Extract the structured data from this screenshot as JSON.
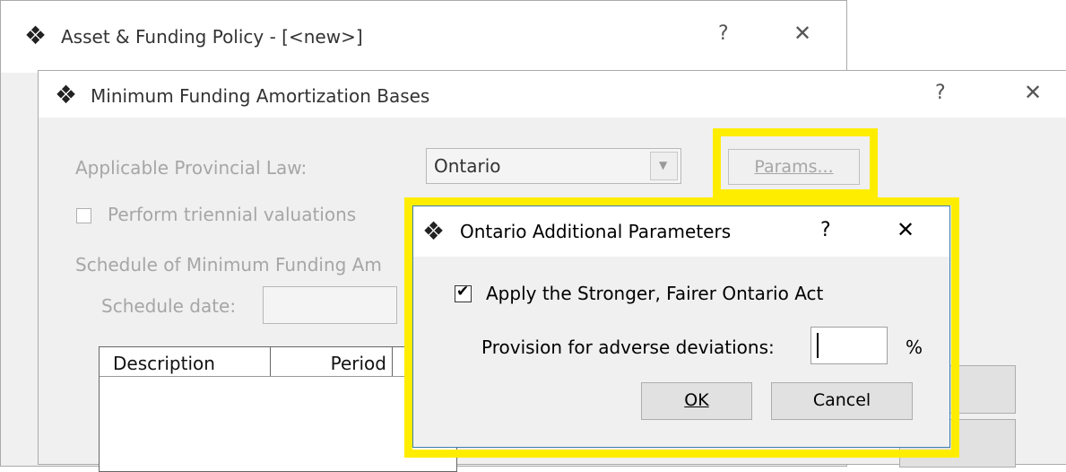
{
  "outer_window": {
    "title": "Asset & Funding Policy - [<new>]",
    "help": "?",
    "close": "✕"
  },
  "amort_window": {
    "title": "Minimum Funding Amortization Bases",
    "help": "?",
    "close": "✕",
    "law_label": "Applicable Provincial Law:",
    "law_value": "Ontario",
    "params_button": "Params...",
    "triennial_label": "Perform triennial valuations",
    "schedule_label": "Schedule of Minimum Funding Am",
    "schedule_date_label": "Schedule date:",
    "columns": [
      "Description",
      "Period"
    ]
  },
  "params_dialog": {
    "title": "Ontario Additional Parameters",
    "help": "?",
    "close": "✕",
    "apply_label": "Apply the Stronger, Fairer Ontario Act",
    "apply_checked": true,
    "pfad_label": "Provision for adverse deviations:",
    "pfad_value": "",
    "pfad_unit": "%",
    "ok_label": "OK",
    "cancel_label": "Cancel"
  },
  "colors": {
    "highlight": "#ffed00",
    "dialog_bg": "#f0f0f0",
    "disabled_text": "#a6a6a6"
  }
}
